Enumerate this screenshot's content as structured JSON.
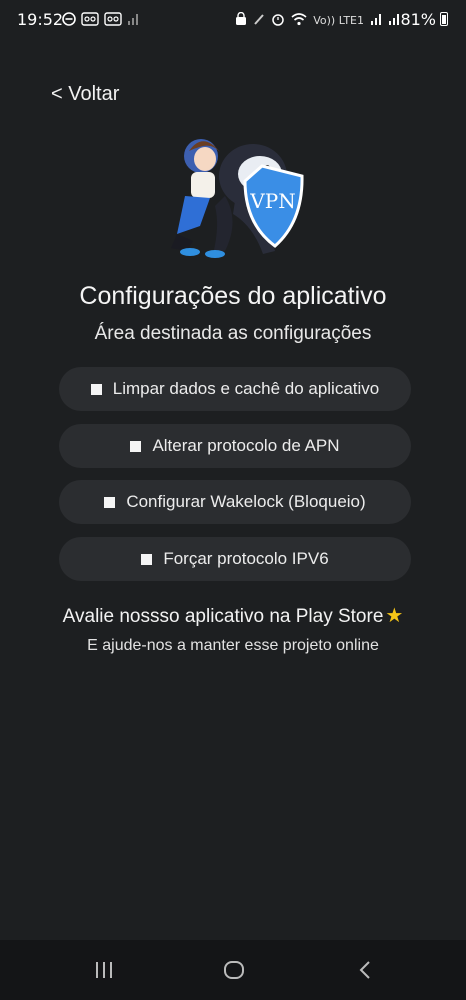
{
  "status": {
    "time": "19:52",
    "battery": "81%",
    "network_label": "Vo)) LTE1"
  },
  "back_label": "< Voltar",
  "title": "Configurações do aplicativo",
  "subtitle": "Área destinada as configurações",
  "options": [
    {
      "label": "Limpar dados e cachê do aplicativo"
    },
    {
      "label": "Alterar protocolo de APN"
    },
    {
      "label": "Configurar Wakelock (Bloqueio)"
    },
    {
      "label": "Forçar protocolo IPV6"
    }
  ],
  "rate": {
    "title": "Avalie nossso aplicativo na Play Store",
    "subtitle": "E ajude-nos a manter esse projeto online"
  },
  "mascot_shield_text": "VPN",
  "colors": {
    "background": "#1d1f21",
    "option_bg": "#2b2d30",
    "star": "#f5c518",
    "shield": "#3a8ee6"
  }
}
